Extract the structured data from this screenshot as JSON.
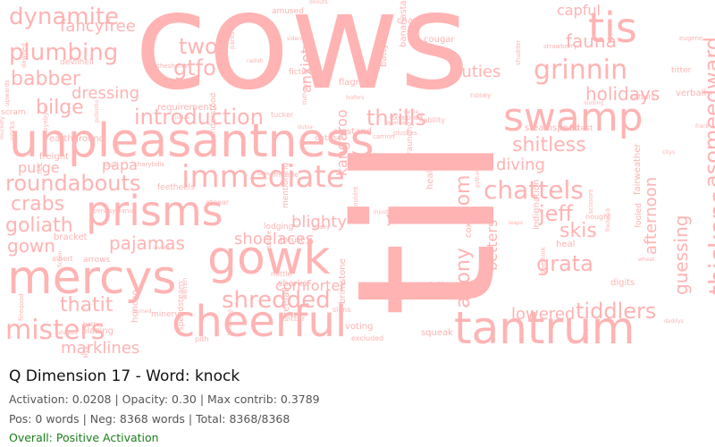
{
  "title": "Q Dimension 17 - Word: knock",
  "stats_line": "Activation: 0.0208 | Opacity: 0.30 | Max contrib: 0.3789",
  "counts_line": "Pos: 0 words | Neg: 8368 words | Total: 8368/8368",
  "overall": "Overall: Positive Activation",
  "colors": {
    "word": "#ffb3b3",
    "overall": "#1a7f1a",
    "meta": "#555555",
    "title": "#111111"
  },
  "words": [
    "cows",
    "til",
    "unpleasantness",
    "mercys",
    "gowk",
    "cheerful",
    "tantrum",
    "swamp",
    "prisms",
    "tis",
    "immediate",
    "introduction",
    "grinnin",
    "chattels",
    "thickens",
    "asome",
    "edward",
    "roundabouts",
    "misters",
    "shredded",
    "dynamite",
    "plumbing",
    "babber",
    "twos",
    "gtfo",
    "bilge",
    "crabs",
    "goliath",
    "pajamas",
    "gown",
    "marklines",
    "thrills",
    "shitless",
    "holidays",
    "duties",
    "diving",
    "roadline",
    "jeff",
    "skis",
    "grata",
    "guessing",
    "afternoon",
    "tiddlers",
    "lowered",
    "agony",
    "loom",
    "shoelaces",
    "blighty",
    "comforter",
    "fancyfree",
    "fauna",
    "capful",
    "dressing",
    "purge",
    "papa",
    "thatit",
    "kangaroo",
    "anxiety",
    "yen",
    "betters"
  ]
}
